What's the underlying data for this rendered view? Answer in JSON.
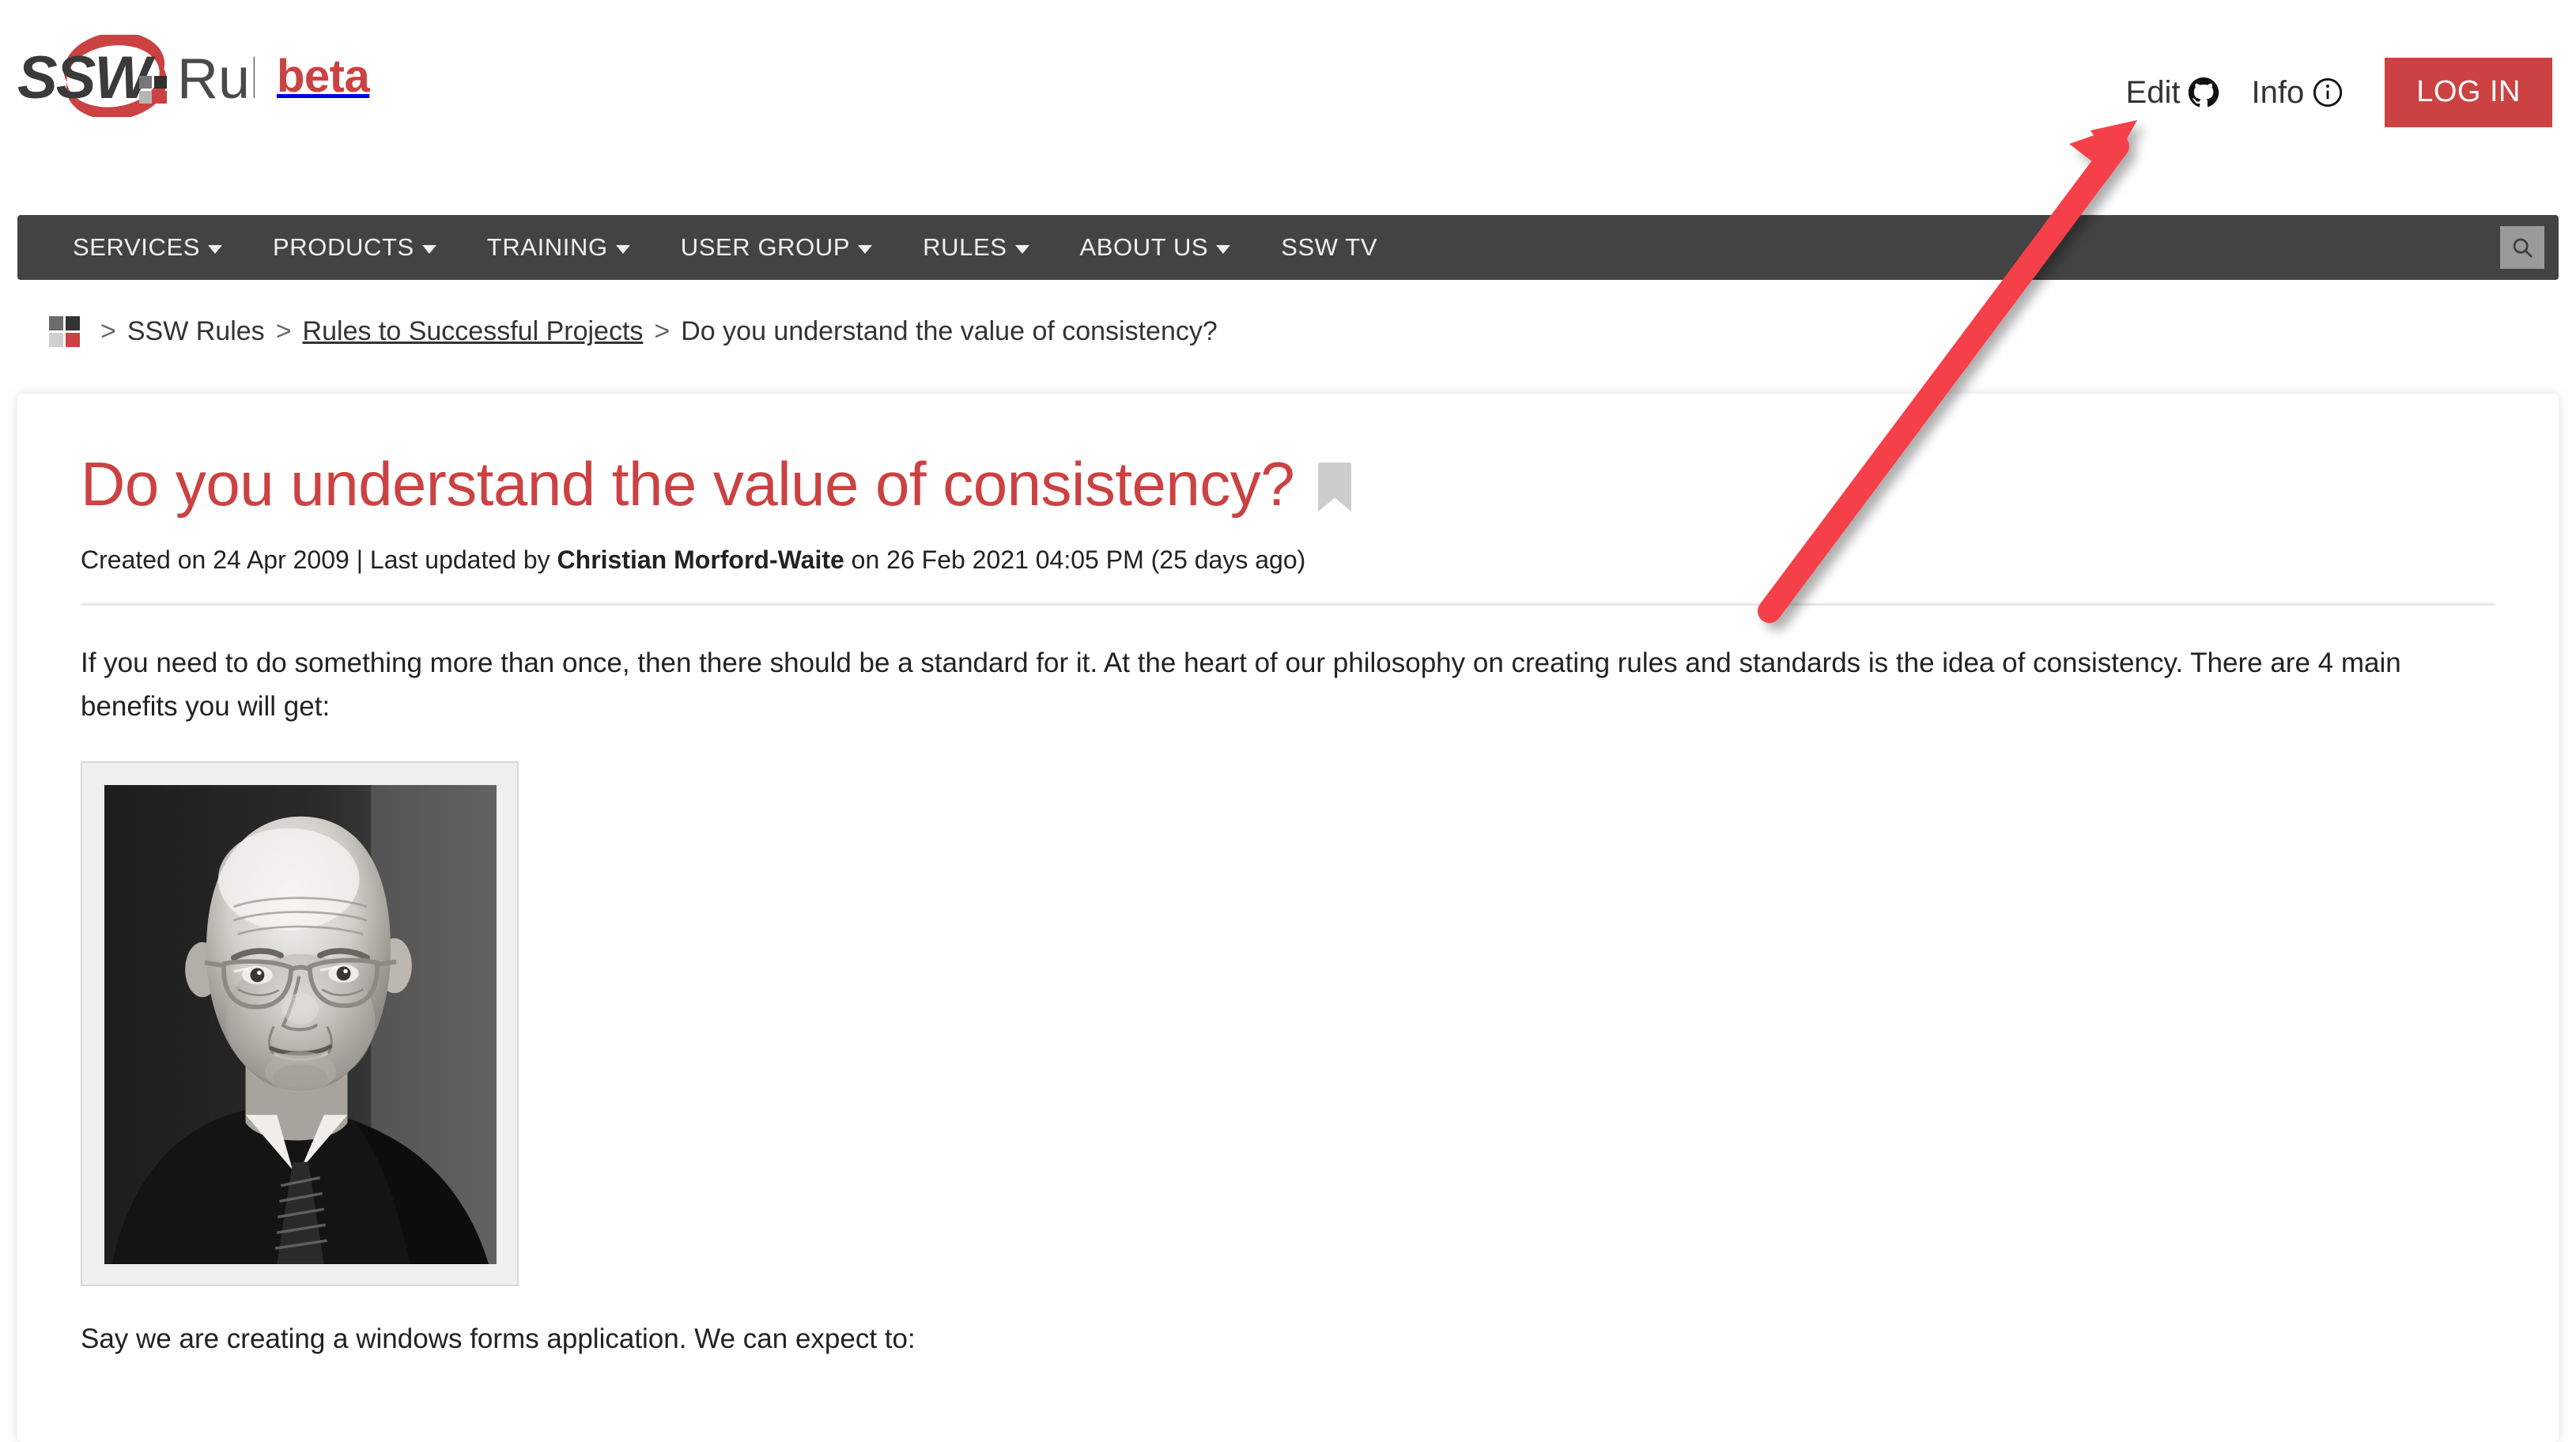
{
  "site": {
    "brand_primary": "SSW",
    "brand_secondary": "Rules",
    "beta_label": "beta",
    "accent_red": "#cc4141",
    "nav_bg": "#434343",
    "text_dark": "#333333"
  },
  "header": {
    "edit_label": "Edit",
    "edit_icon": "github-icon",
    "info_label": "Info",
    "info_icon": "info-circle-icon",
    "login_label": "LOG IN"
  },
  "nav": {
    "items": [
      {
        "label": "SERVICES",
        "has_caret": true
      },
      {
        "label": "PRODUCTS",
        "has_caret": true
      },
      {
        "label": "TRAINING",
        "has_caret": true
      },
      {
        "label": "USER GROUP",
        "has_caret": true
      },
      {
        "label": "RULES",
        "has_caret": true
      },
      {
        "label": "ABOUT US",
        "has_caret": true
      },
      {
        "label": "SSW TV",
        "has_caret": false
      }
    ],
    "search_icon": "search-icon"
  },
  "breadcrumb": {
    "home_icon": "ssw-squares-icon",
    "separator": ">",
    "items": [
      {
        "label": "SSW Rules",
        "underlined": false,
        "current": false
      },
      {
        "label": "Rules to Successful Projects",
        "underlined": true,
        "current": false
      },
      {
        "label": "Do you understand the value of consistency?",
        "underlined": false,
        "current": true
      }
    ]
  },
  "article": {
    "title": "Do you understand the value of consistency?",
    "bookmark_icon": "bookmark-icon",
    "meta": {
      "created_prefix": "Created on 24 Apr 2009 | Last updated by ",
      "author": "Christian Morford-Waite",
      "created_suffix": " on 26 Feb 2021 04:05 PM (25 days ago)"
    },
    "paragraph_1": "If you need to do something more than once, then there should be a standard for it. At the heart of our philosophy on creating rules and standards is the idea of consistency. There are 4 main benefits you will get:",
    "figure_alt": "black-and-white portrait photograph of an older bald man wearing glasses",
    "paragraph_2": "Say we are creating a windows forms application. We can expect to:"
  },
  "annotation": {
    "type": "arrow",
    "color": "#f5404a",
    "points_to": "Edit"
  }
}
